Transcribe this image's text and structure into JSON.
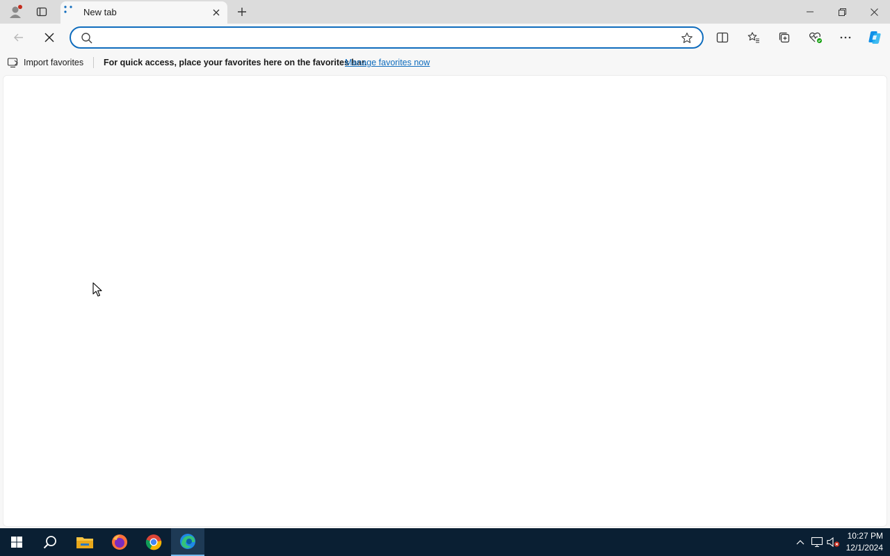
{
  "tab": {
    "title": "New tab"
  },
  "address": {
    "value": "",
    "placeholder": ""
  },
  "favorites_bar": {
    "import_label": "Import favorites",
    "message": "For quick access, place your favorites here on the favorites bar.",
    "link_label": "Manage favorites now"
  },
  "taskbar": {
    "time": "10:27 PM",
    "date": "12/1/2024",
    "apps": [
      "file-explorer",
      "firefox",
      "chrome",
      "edge"
    ]
  },
  "colors": {
    "accent": "#0f6cbd",
    "taskbar": "#0a1f33",
    "profile_badge": "#c42b1c"
  }
}
